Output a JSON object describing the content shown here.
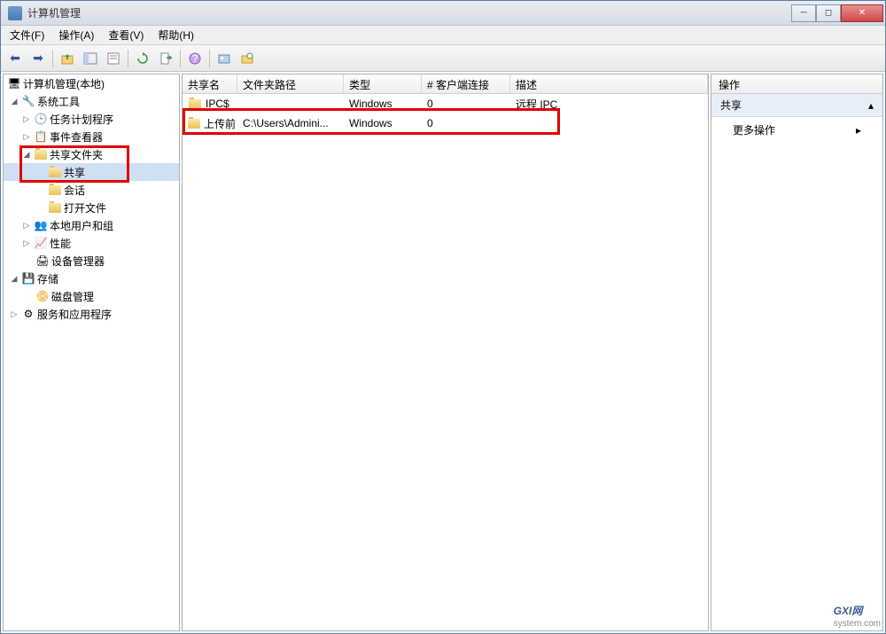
{
  "window": {
    "title": "计算机管理"
  },
  "menu": {
    "file": "文件(F)",
    "action": "操作(A)",
    "view": "查看(V)",
    "help": "帮助(H)"
  },
  "tree": {
    "root": "计算机管理(本地)",
    "system_tools": "系统工具",
    "task_scheduler": "任务计划程序",
    "event_viewer": "事件查看器",
    "shared_folders": "共享文件夹",
    "shares": "共享",
    "sessions": "会话",
    "open_files": "打开文件",
    "local_users": "本地用户和组",
    "performance": "性能",
    "device_manager": "设备管理器",
    "storage": "存储",
    "disk_management": "磁盘管理",
    "services_apps": "服务和应用程序"
  },
  "columns": {
    "share_name": "共享名",
    "folder_path": "文件夹路径",
    "type": "类型",
    "client_connections": "# 客户端连接",
    "description": "描述"
  },
  "rows": [
    {
      "name": "IPC$",
      "path": "",
      "type": "Windows",
      "conns": "0",
      "desc": "远程 IPC"
    },
    {
      "name": "上传前",
      "path": "C:\\Users\\Admini...",
      "type": "Windows",
      "conns": "0",
      "desc": ""
    }
  ],
  "actions": {
    "header": "操作",
    "section": "共享",
    "more": "更多操作"
  },
  "watermark": {
    "big": "GXI网",
    "small": "system.com"
  }
}
